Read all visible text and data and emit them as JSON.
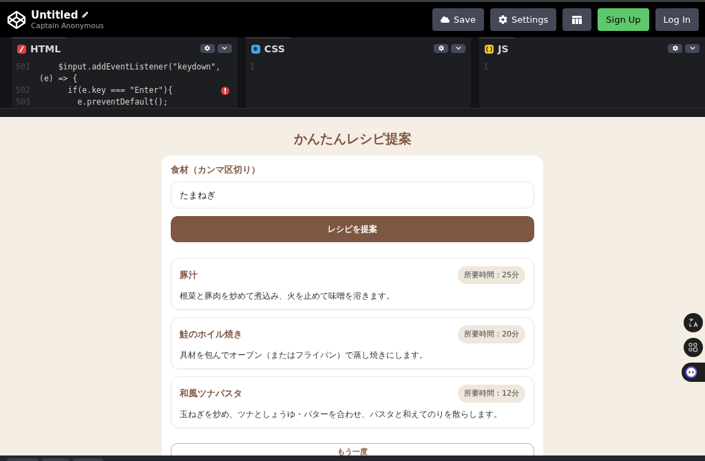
{
  "header": {
    "title": "Untitled",
    "author": "Captain Anonymous",
    "buttons": [
      {
        "kind": "save",
        "label": "Save"
      },
      {
        "kind": "settings",
        "label": "Settings"
      },
      {
        "kind": "layout"
      },
      {
        "kind": "signup",
        "label": "Sign Up"
      },
      {
        "kind": "login",
        "label": "Log In"
      }
    ]
  },
  "editors": [
    {
      "kind": "html",
      "label": "HTML",
      "lines": [
        {
          "number": "501",
          "text": "    $input.addEventListener(\"keydown\","
        },
        {
          "text": "(e) => {"
        },
        {
          "number": "502",
          "text": "      if(e.key === \"Enter\"){",
          "error": true
        },
        {
          "number": "503",
          "text": "        e.preventDefault();"
        }
      ]
    },
    {
      "kind": "css",
      "label": "CSS",
      "lines": [
        {
          "number": "1"
        }
      ]
    },
    {
      "kind": "js",
      "label": "JS",
      "lines": [
        {
          "number": "1"
        }
      ]
    }
  ],
  "preview": {
    "title": "かんたんレシピ提案",
    "field_label": "食材（カンマ区切り）",
    "field_value": "たまねぎ",
    "submit": "レシピを提案",
    "recipes": [
      {
        "name": "豚汁",
        "time": "所要時間：25分",
        "description": "根菜と豚肉を炒めて煮込み、火を止めて味噌を溶きます。"
      },
      {
        "name": "鮭のホイル焼き",
        "time": "所要時間：20分",
        "description": "具材を包んでオーブン（またはフライパン）で蒸し焼きにします。"
      },
      {
        "name": "和風ツナパスタ",
        "time": "所要時間：12分",
        "description": "玉ねぎを炒め、ツナとしょうゆ・バターを合わせ、パスタと和えてのりを散らします。"
      }
    ],
    "retry": "もう一度"
  }
}
